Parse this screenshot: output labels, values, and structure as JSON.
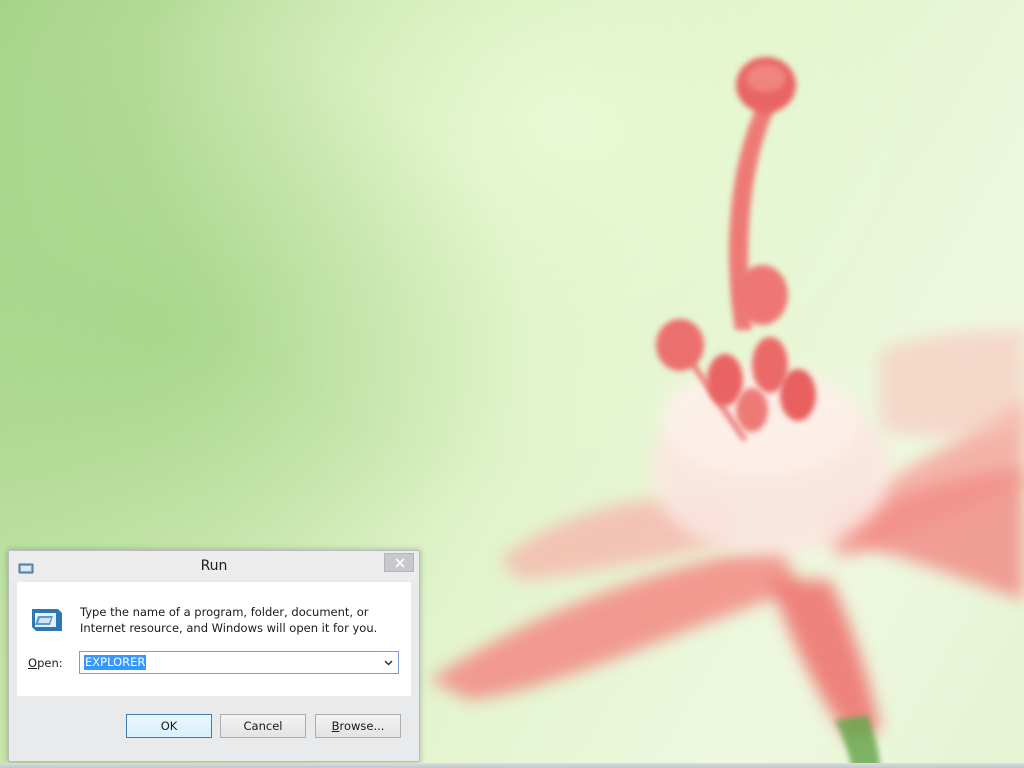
{
  "dialog": {
    "title": "Run",
    "app_icon": "run-app-icon",
    "close_icon": "close-icon",
    "run_icon": "run-program-icon",
    "description": "Type the name of a program, folder, document, or Internet resource, and Windows will open it for you.",
    "open_label_mnemonic": "O",
    "open_label_rest": "pen:",
    "open_value": "EXPLORER",
    "dropdown_icon": "chevron-down-icon"
  },
  "buttons": {
    "ok_label": "OK",
    "cancel_label": "Cancel",
    "browse_mnemonic": "B",
    "browse_rest": "rowse..."
  },
  "colors": {
    "selection": "#3399ff",
    "default_button_border": "#3c7fb1",
    "wallpaper_green": "#c6e6ab",
    "flower_pink": "#f07f7c"
  }
}
